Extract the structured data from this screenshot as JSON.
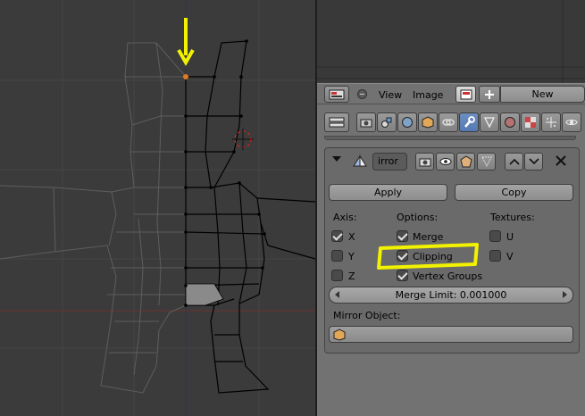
{
  "header": {
    "view_label": "View",
    "image_label": "Image",
    "new_label": "New"
  },
  "modifier": {
    "name_value": "irror",
    "apply_label": "Apply",
    "copy_label": "Copy",
    "axis_heading": "Axis:",
    "options_heading": "Options:",
    "textures_heading": "Textures:",
    "axis": [
      {
        "label": "X",
        "checked": true
      },
      {
        "label": "Y",
        "checked": false
      },
      {
        "label": "Z",
        "checked": false
      }
    ],
    "options": [
      {
        "label": "Merge",
        "checked": true
      },
      {
        "label": "Clipping",
        "checked": true
      },
      {
        "label": "Vertex Groups",
        "checked": true
      }
    ],
    "textures": [
      {
        "label": "U",
        "checked": false
      },
      {
        "label": "V",
        "checked": false
      }
    ],
    "merge_limit_label": "Merge Limit:",
    "merge_limit_value": "0.001000",
    "merge_limit_text": "Merge Limit: 0.001000",
    "mirror_object_label": "Mirror Object:",
    "mirror_object_value": ""
  },
  "properties_tabs": [
    "render-icon",
    "scene-icon",
    "world-icon",
    "object-icon",
    "constraints-icon",
    "modifiers-icon",
    "data-icon",
    "material-icon",
    "texture-icon",
    "particles-icon",
    "physics-icon"
  ],
  "colors": {
    "annotation": "#f2f200",
    "active_tab": "#5579b3",
    "panel_bg": "#727272",
    "viewport_bg": "#3b3b3b"
  }
}
